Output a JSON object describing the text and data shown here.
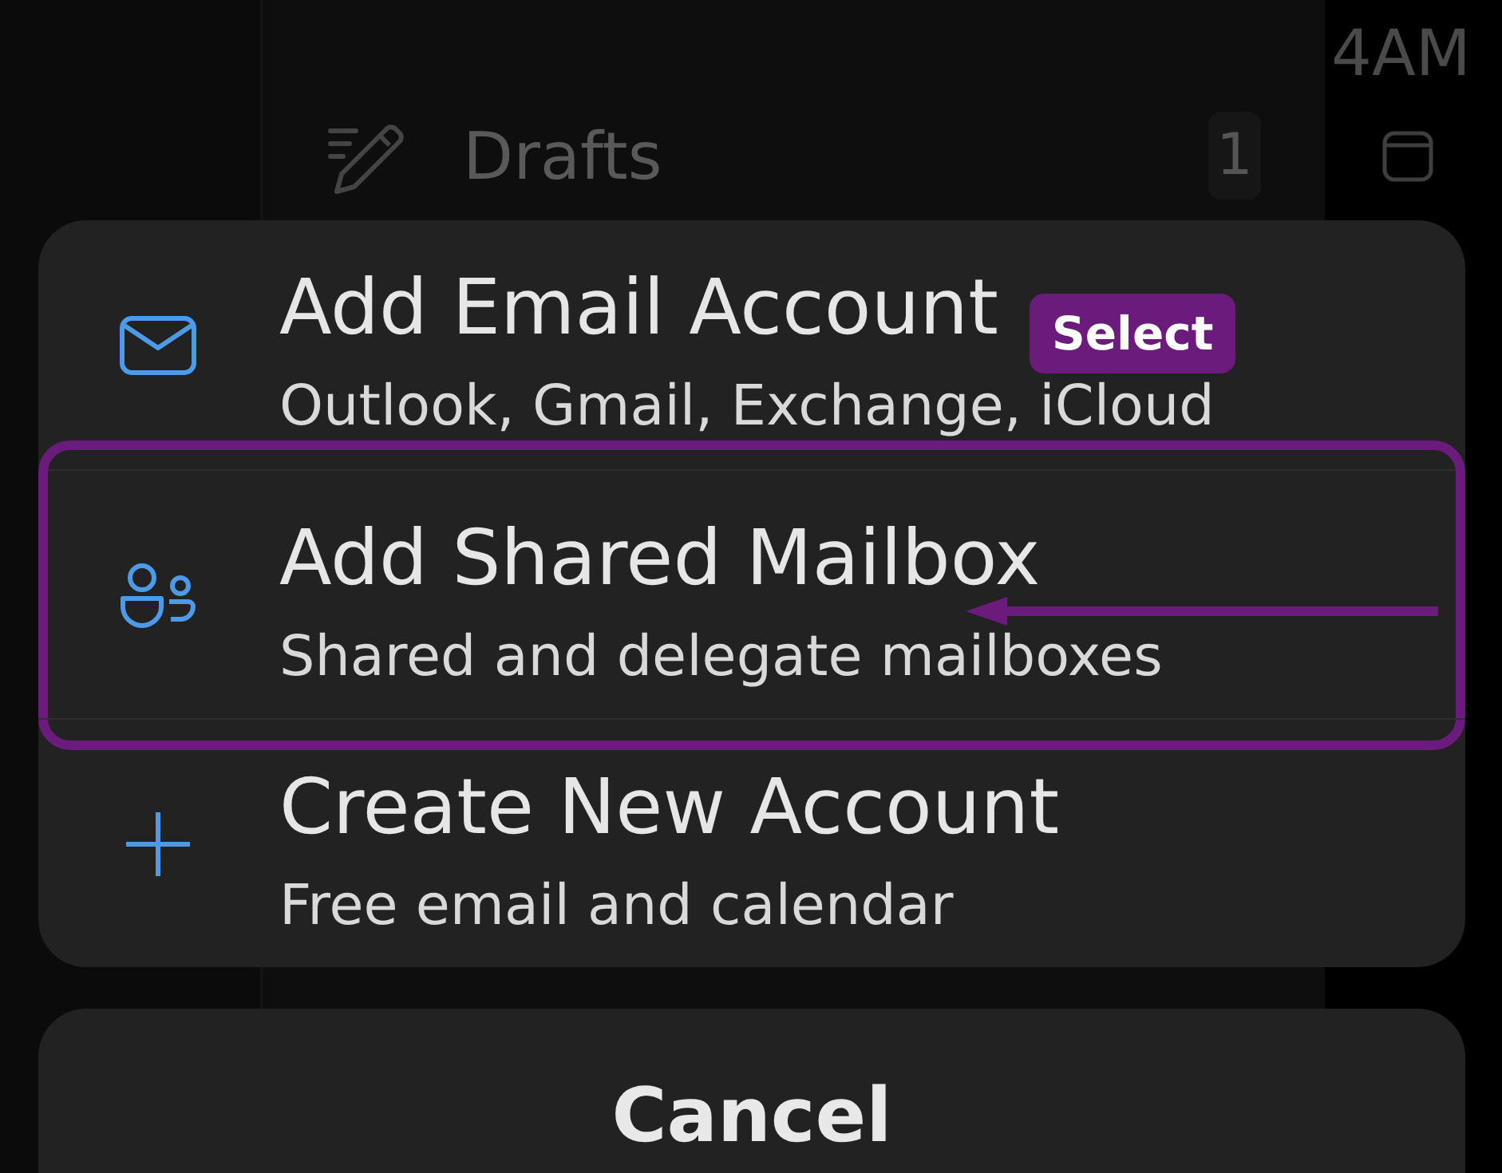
{
  "sidebar": {
    "items": [
      {
        "label": "Drafts",
        "count": "1"
      }
    ]
  },
  "message_list": {
    "time": "4AM"
  },
  "action_sheet": {
    "options": [
      {
        "kind": "mail",
        "title": "Add Email Account",
        "subtitle": "Outlook, Gmail, Exchange, iCloud",
        "highlighted": false
      },
      {
        "kind": "shared",
        "title": "Add Shared Mailbox",
        "subtitle": "Shared and delegate mailboxes",
        "highlighted": true
      },
      {
        "kind": "create",
        "title": "Create New Account",
        "subtitle": "Free email and calendar",
        "highlighted": false
      }
    ],
    "cancel": "Cancel"
  },
  "annotation": {
    "label": "Select"
  }
}
